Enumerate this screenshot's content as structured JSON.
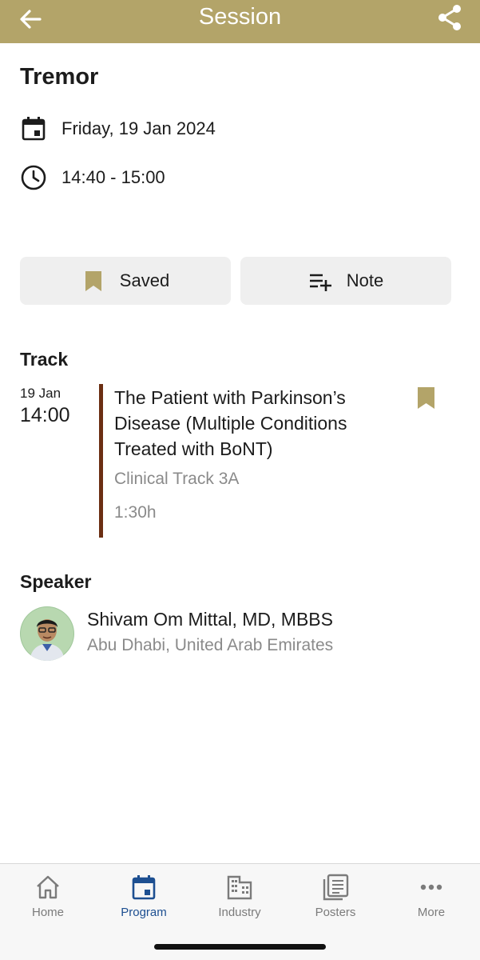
{
  "header": {
    "title": "Session",
    "back_icon": "arrow-left-icon",
    "share_icon": "share-icon",
    "background_color": "#b3a469"
  },
  "session": {
    "title": "Tremor",
    "date": "Friday, 19 Jan 2024",
    "time": "14:40 - 15:00",
    "date_icon": "calendar-icon",
    "time_icon": "clock-icon"
  },
  "actions": {
    "saved_label": "Saved",
    "note_label": "Note",
    "saved_icon": "bookmark-icon",
    "note_icon": "playlist-add-icon"
  },
  "track": {
    "heading": "Track",
    "date": "19 Jan",
    "time": "14:00",
    "title": "The Patient with Parkinson’s Disease (Multiple Conditions Treated with BoNT)",
    "subtitle": "Clinical Track 3A",
    "duration": "1:30h",
    "bar_color": "#6b2e12",
    "bookmark_icon": "bookmark-icon"
  },
  "speaker": {
    "heading": "Speaker",
    "name": "Shivam Om Mittal, MD, MBBS",
    "location": "Abu Dhabi, United Arab Emirates"
  },
  "tabbar": {
    "active_color": "#1d4f91",
    "tabs": [
      {
        "label": "Home",
        "icon": "home-icon"
      },
      {
        "label": "Program",
        "icon": "calendar-icon"
      },
      {
        "label": "Industry",
        "icon": "building-icon"
      },
      {
        "label": "Posters",
        "icon": "posters-icon"
      },
      {
        "label": "More",
        "icon": "more-icon"
      }
    ]
  }
}
